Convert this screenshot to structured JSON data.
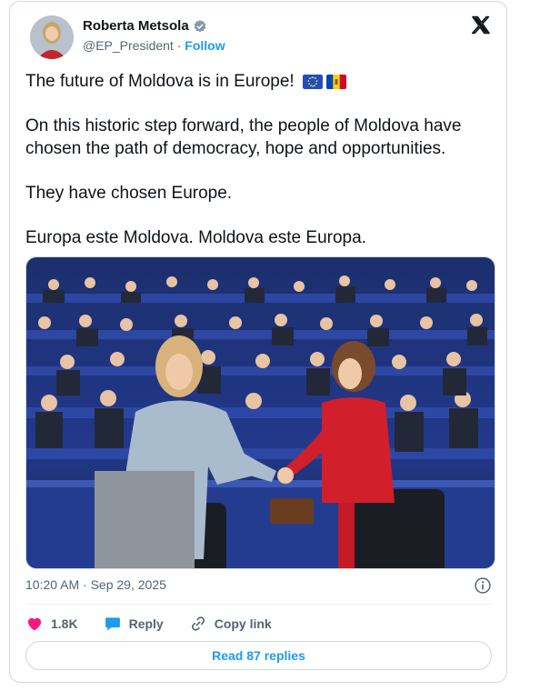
{
  "author": {
    "name": "Roberta Metsola",
    "handle": "@EP_President",
    "separator": "·",
    "follow_label": "Follow"
  },
  "tweet": {
    "paragraphs": [
      "The future of Moldova is in Europe!",
      "On this historic step forward, the people of Moldova have chosen the path of democracy, hope and opportunities.",
      "They have chosen Europe.",
      "Europa este Moldova. Moldova este Europa."
    ],
    "emoji": [
      "eu-flag-icon",
      "moldova-flag-icon"
    ]
  },
  "timestamp": "10:20 AM · Sep 29, 2025",
  "actions": {
    "likes_count": "1.8K",
    "reply_label": "Reply",
    "copy_link_label": "Copy link"
  },
  "replies_button_label": "Read 87 replies",
  "colors": {
    "accent": "#1d9bf0",
    "heart": "#f91880",
    "text": "#0f1419",
    "muted": "#536471",
    "border": "#cfd9de"
  }
}
